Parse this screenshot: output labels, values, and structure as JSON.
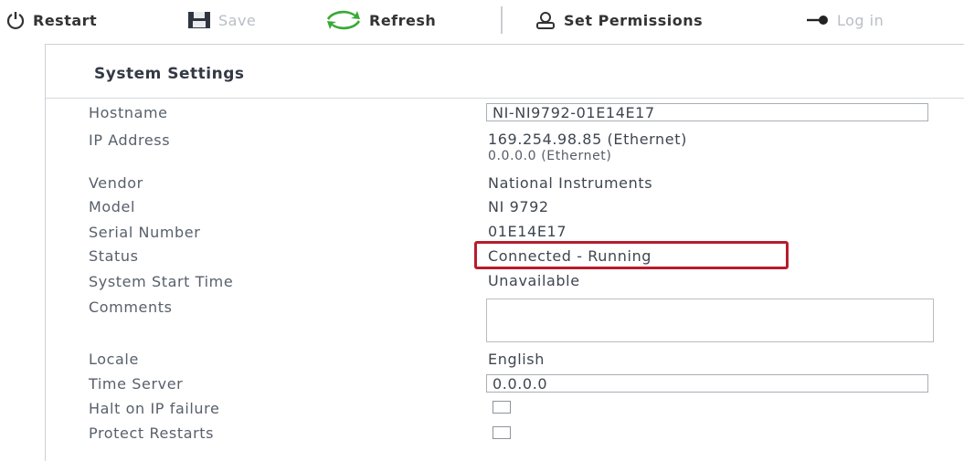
{
  "toolbar": {
    "restart_label": "Restart",
    "save_label": "Save",
    "refresh_label": "Refresh",
    "set_permissions_label": "Set Permissions",
    "login_label": "Log in"
  },
  "panel": {
    "title": "System Settings",
    "hostname_label": "Hostname",
    "hostname_value": "NI-NI9792-01E14E17",
    "ip_address_label": "IP Address",
    "ip_address_value_1": "169.254.98.85 (Ethernet)",
    "ip_address_value_2": "0.0.0.0 (Ethernet)",
    "vendor_label": "Vendor",
    "vendor_value": "National Instruments",
    "model_label": "Model",
    "model_value": "NI 9792",
    "serial_number_label": "Serial Number",
    "serial_number_value": "01E14E17",
    "status_label": "Status",
    "status_value": "Connected - Running",
    "start_time_label": "System Start Time",
    "start_time_value": "Unavailable",
    "comments_label": "Comments",
    "comments_value": "",
    "locale_label": "Locale",
    "locale_value": "English",
    "time_server_label": "Time Server",
    "time_server_value": "0.0.0.0",
    "halt_on_ip_failure_label": "Halt on IP failure",
    "protect_restarts_label": "Protect Restarts"
  },
  "colors": {
    "highlight": "#b71c2c",
    "refresh_icon": "#3aa935",
    "text": "#333a45"
  },
  "icons": [
    "power-icon",
    "save-icon",
    "refresh-icon",
    "permissions-icon",
    "login-icon"
  ]
}
